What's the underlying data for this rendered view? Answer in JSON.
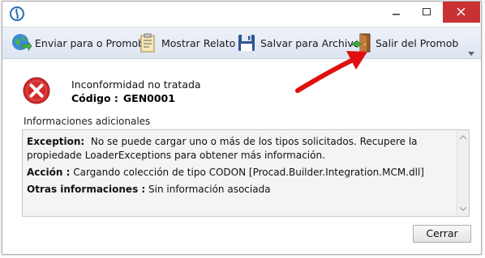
{
  "window": {
    "controls": {
      "minimize": "minimize",
      "maximize": "maximize",
      "close": "close"
    },
    "close_color": "#c83232"
  },
  "toolbar": {
    "items": [
      {
        "label": "Enviar para o Promob",
        "icon": "globe-send-icon"
      },
      {
        "label": "Mostrar Relato",
        "icon": "clipboard-report-icon"
      },
      {
        "label": "Salvar para Archivo",
        "icon": "floppy-disk-icon"
      },
      {
        "label": "Salir del Promob",
        "icon": "exit-door-icon"
      }
    ]
  },
  "error": {
    "title": "Inconformidad no tratada",
    "code_label": "Código :",
    "code_value": "GEN0001",
    "icon": "error-x-icon",
    "icon_color": "#d42a2a"
  },
  "details": {
    "section_label": "Informaciones adicionales",
    "exception_label": "Exception:",
    "exception_text": "No se puede cargar uno o más de los tipos solicitados. Recupere la propiedade LoaderExceptions para obtener más información.",
    "action_label": "Acción :",
    "action_text": "Cargando colección de tipo CODON [Procad.Builder.Integration.MCM.dll]",
    "other_label": "Otras informaciones :",
    "other_text": "Sin información asociada"
  },
  "buttons": {
    "close_label": "Cerrar"
  },
  "annotation": {
    "arrow_color": "#e01010"
  }
}
